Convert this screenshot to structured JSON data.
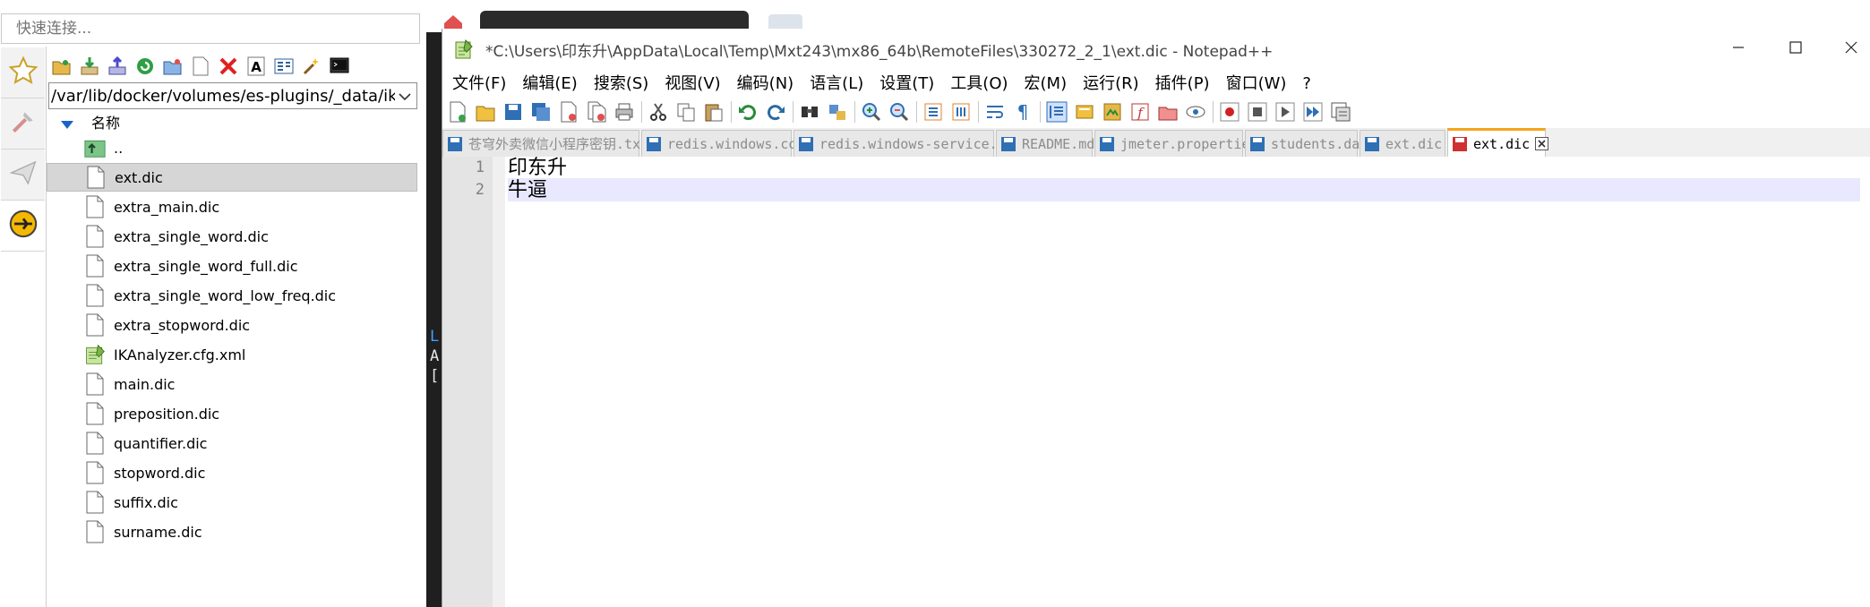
{
  "quick_connect": {
    "placeholder": "快速连接..."
  },
  "sftp": {
    "path": "/var/lib/docker/volumes/es-plugins/_data/ik/co",
    "column_name": "名称",
    "files": [
      {
        "name": "..",
        "type": "up"
      },
      {
        "name": "ext.dic",
        "type": "file",
        "selected": true
      },
      {
        "name": "extra_main.dic",
        "type": "file"
      },
      {
        "name": "extra_single_word.dic",
        "type": "file"
      },
      {
        "name": "extra_single_word_full.dic",
        "type": "file"
      },
      {
        "name": "extra_single_word_low_freq.dic",
        "type": "file"
      },
      {
        "name": "extra_stopword.dic",
        "type": "file"
      },
      {
        "name": "IKAnalyzer.cfg.xml",
        "type": "xml"
      },
      {
        "name": "main.dic",
        "type": "file"
      },
      {
        "name": "preposition.dic",
        "type": "file"
      },
      {
        "name": "quantifier.dic",
        "type": "file"
      },
      {
        "name": "stopword.dic",
        "type": "file"
      },
      {
        "name": "suffix.dic",
        "type": "file"
      },
      {
        "name": "surname.dic",
        "type": "file"
      }
    ]
  },
  "terminal": {
    "letters": [
      "L",
      "A",
      "["
    ]
  },
  "notepad": {
    "title": "*C:\\Users\\印东升\\AppData\\Local\\Temp\\Mxt243\\mx86_64b\\RemoteFiles\\330272_2_1\\ext.dic - Notepad++",
    "menu": [
      "文件(F)",
      "编辑(E)",
      "搜索(S)",
      "视图(V)",
      "编码(N)",
      "语言(L)",
      "设置(T)",
      "工具(O)",
      "宏(M)",
      "运行(R)",
      "插件(P)",
      "窗口(W)",
      "?"
    ],
    "tabs": [
      {
        "label": "苍穹外卖微信小程序密钥.txt",
        "active": false
      },
      {
        "label": "redis.windows.conf",
        "active": false
      },
      {
        "label": "redis.windows-service.conf",
        "active": false
      },
      {
        "label": "README.md",
        "active": false
      },
      {
        "label": "jmeter.properties",
        "active": false
      },
      {
        "label": "students.dat",
        "active": false
      },
      {
        "label": "ext.dic",
        "active": false
      },
      {
        "label": "ext.dic",
        "active": true
      }
    ],
    "lines": [
      {
        "num": "1",
        "text": "印东升"
      },
      {
        "num": "2",
        "text": "牛逼"
      }
    ]
  },
  "colors": {
    "accent_tab": "#f6a31c",
    "current_line": "#e8e8ff",
    "save_icon": "#2f6fb3"
  }
}
